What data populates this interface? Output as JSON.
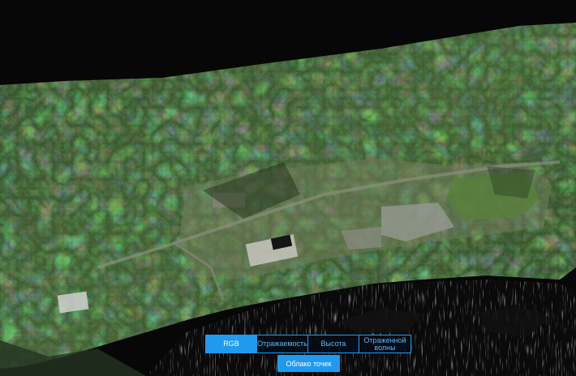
{
  "viewer": {
    "modes": [
      {
        "label": "RGB",
        "active": true
      },
      {
        "label": "Отражаемость",
        "active": false
      },
      {
        "label": "Высота",
        "active": false
      },
      {
        "label": "Отраженной волны",
        "active": false
      }
    ],
    "point_cloud_button": "Облако точек"
  },
  "colors": {
    "accent": "#1e9bf0",
    "accent_text": "#5bb8f5",
    "background": "#070707"
  }
}
